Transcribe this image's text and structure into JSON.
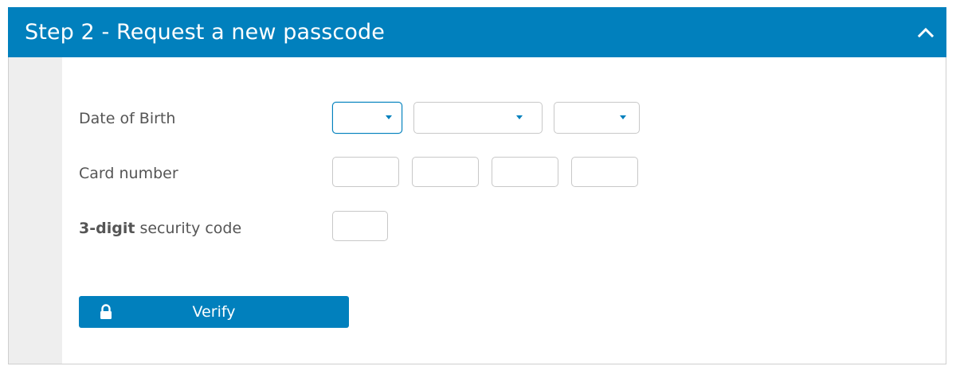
{
  "header": {
    "title": "Step 2 - Request a new passcode",
    "collapse_icon": "chevron-up-icon"
  },
  "form": {
    "dob": {
      "label": "Date of Birth",
      "day_value": "",
      "month_value": "",
      "year_value": ""
    },
    "card": {
      "label": "Card number",
      "parts": [
        "",
        "",
        "",
        ""
      ]
    },
    "security": {
      "label_bold": "3-digit",
      "label_rest": " security code",
      "value": ""
    }
  },
  "verify": {
    "label": "Verify",
    "icon": "lock-icon"
  },
  "colors": {
    "accent": "#0180bd",
    "side_strip": "#eeeeee",
    "border": "#c8c8c8",
    "label_text": "#555555"
  }
}
